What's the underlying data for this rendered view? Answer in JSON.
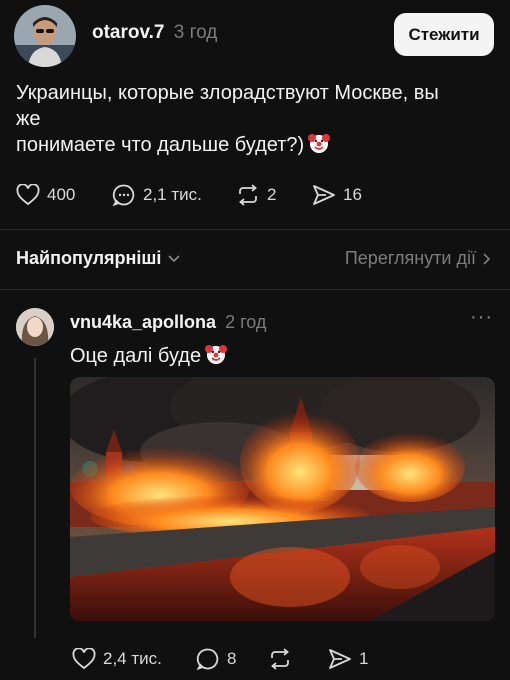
{
  "post": {
    "username": "otarov.7",
    "time": "3 год",
    "follow_label": "Стежити",
    "text_line1": "Украинцы, которые злорадствуют Москве, вы",
    "text_line2": "же",
    "text_line3": "понимаете что дальше будет?)",
    "emoji": "clown-face-icon",
    "likes": "400",
    "comments": "2,1 тис.",
    "reposts": "2",
    "shares": "16"
  },
  "replies_bar": {
    "sort_label": "Найпопулярніші",
    "activity_label": "Переглянути дії"
  },
  "reply": {
    "username": "vnu4ka_apollona",
    "time": "2 год",
    "more": "···",
    "text": "Оце далі буде",
    "likes": "2,4 тис.",
    "comments": "8",
    "reposts": "",
    "shares": "1"
  },
  "colors": {
    "background": "#101010",
    "muted": "#7b7b7b",
    "button_bg": "#f4f4f4"
  }
}
